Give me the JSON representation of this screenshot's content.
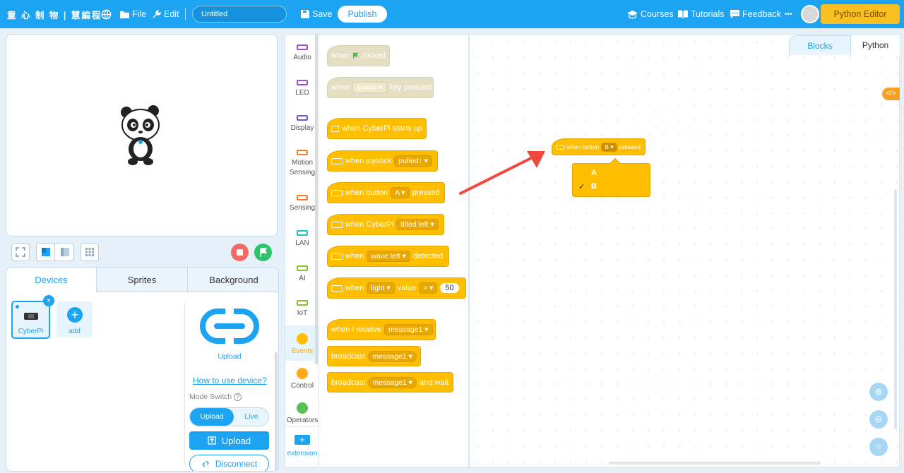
{
  "header": {
    "logo": "童 心 制 物 | 慧編程",
    "file": "File",
    "edit": "Edit",
    "project_title": "Untitled",
    "save": "Save",
    "publish": "Publish",
    "courses": "Courses",
    "tutorials": "Tutorials",
    "feedback": "Feedback",
    "more": "•••",
    "python_editor": "Python Editor"
  },
  "device_tabs": [
    "Devices",
    "Sprites",
    "Background"
  ],
  "devices": {
    "cyberpi": "CyberPi",
    "add": "add",
    "upload_label": "Upload",
    "how_to": "How to use device?",
    "mode_switch": "Mode Switch",
    "mode_upload": "Upload",
    "mode_live": "Live",
    "upload_btn": "Upload",
    "disconnect_btn": "Disconnect"
  },
  "categories": [
    {
      "label": "Audio",
      "color": "#9a4fd1"
    },
    {
      "label": "LED",
      "color": "#9a4fd1"
    },
    {
      "label": "Display",
      "color": "#7a4fd1"
    },
    {
      "label": "Motion Sensing",
      "color": "#ff7a2a"
    },
    {
      "label": "Sensing",
      "color": "#ff7a2a"
    },
    {
      "label": "LAN",
      "color": "#1fc3b8"
    },
    {
      "label": "AI",
      "color": "#8ac12a"
    },
    {
      "label": "IoT",
      "color": "#8ac12a"
    },
    {
      "label": "Events",
      "color": "#ffbf00"
    },
    {
      "label": "Control",
      "color": "#ffab19"
    },
    {
      "label": "Operators",
      "color": "#59c059"
    },
    {
      "label": "extension",
      "color": "#1ca3f2"
    }
  ],
  "blocks": {
    "b1": {
      "when": "when",
      "clicked": "clicked"
    },
    "b2": {
      "when": "when",
      "key": "space",
      "pressed": "key pressed"
    },
    "b3": {
      "text": "when CyberPi starts up"
    },
    "b4": {
      "when": "when joystick",
      "dd": "pulled↑"
    },
    "b5": {
      "when": "when button",
      "dd": "A",
      "pressed": "pressed"
    },
    "b6": {
      "when": "when CyberPi",
      "dd": "tilted left"
    },
    "b7": {
      "when": "when",
      "dd": "wave left",
      "detected": "detected"
    },
    "b8": {
      "when": "when",
      "dd1": "light",
      "value": "value",
      "dd2": ">",
      "num": "50"
    },
    "b9": {
      "text": "when I receive",
      "dd": "message1"
    },
    "b10": {
      "text": "broadcast",
      "dd": "message1"
    },
    "b11": {
      "text": "broadcast",
      "dd": "message1",
      "tail": "and wait"
    }
  },
  "workspace": {
    "tab_blocks": "Blocks",
    "tab_python": "Python",
    "block_when": "when button",
    "block_dd": "B",
    "block_pressed": "pressed",
    "options": [
      "A",
      "B"
    ],
    "checkmark": "✓"
  }
}
